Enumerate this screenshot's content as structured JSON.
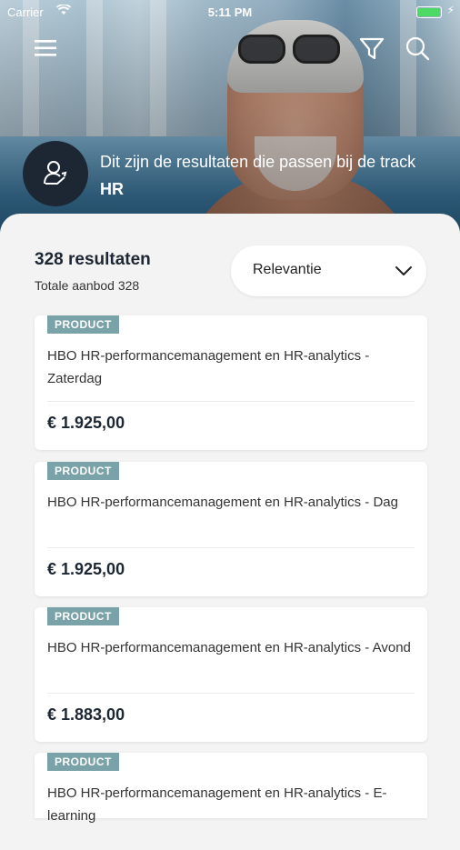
{
  "status_bar": {
    "carrier": "Carrier",
    "time": "5:11 PM"
  },
  "header": {
    "intro_text": "Dit zijn de resultaten die passen bij de track",
    "track_name": "HR"
  },
  "results": {
    "count_label": "328 resultaten",
    "total_label": "Totale aanbod 328",
    "sort": {
      "selected": "Relevantie"
    }
  },
  "cards": [
    {
      "tag": "PRODUCT",
      "title": "HBO HR-performancemanagement en HR-analytics - Zaterdag",
      "price": "€ 1.925,00"
    },
    {
      "tag": "PRODUCT",
      "title": "HBO HR-performancemanagement en HR-analytics - Dag",
      "price": "€ 1.925,00"
    },
    {
      "tag": "PRODUCT",
      "title": "HBO HR-performancemanagement en HR-analytics - Avond",
      "price": "€ 1.883,00"
    },
    {
      "tag": "PRODUCT",
      "title": "HBO HR-performancemanagement en HR-analytics - E-learning",
      "price": ""
    }
  ],
  "icons": {
    "menu": "menu-icon",
    "filter": "filter-icon",
    "search": "search-icon",
    "track": "person-track-icon"
  },
  "colors": {
    "dark_navy": "#1c2733",
    "tag_teal": "#7aa3a9",
    "background": "#f3f3f3"
  }
}
